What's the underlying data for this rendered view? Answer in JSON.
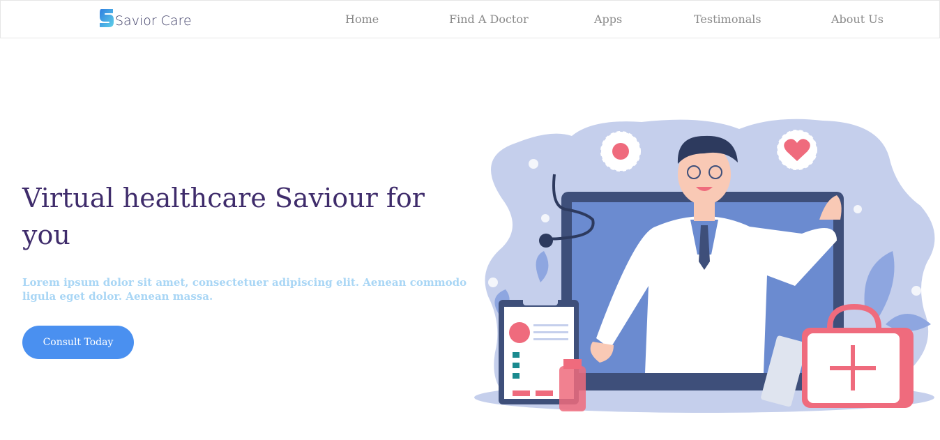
{
  "brand": {
    "name": "Savior Care",
    "logo_letter": "S",
    "logo_color": "#4aa3e8"
  },
  "nav": {
    "items": [
      {
        "label": "Home"
      },
      {
        "label": "Find A Doctor"
      },
      {
        "label": "Apps"
      },
      {
        "label": "Testimonals"
      },
      {
        "label": "About Us"
      }
    ]
  },
  "hero": {
    "title": "Virtual healthcare Saviour for you",
    "subtitle": "Lorem ipsum dolor sit amet, consectetuer adipiscing elit. Aenean commodo ligula eget dolor. Aenean massa.",
    "cta_label": "Consult Today"
  },
  "colors": {
    "title": "#3f2c6b",
    "subtitle": "#a9d6f5",
    "accent": "#4a90f0",
    "illustration_blob": "#c5cfec",
    "screen_blue": "#6b8bd0",
    "coral": "#ef6b7d"
  },
  "illustration": {
    "subject": "doctor-on-laptop-illustration"
  }
}
